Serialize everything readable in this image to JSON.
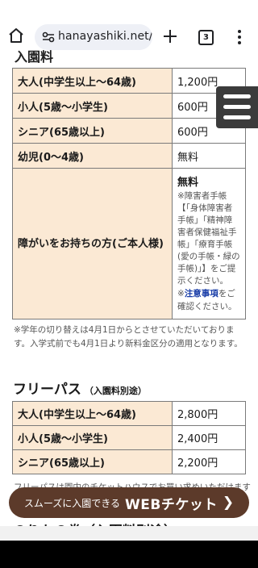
{
  "browser": {
    "url": "hanayashiki.net/f",
    "tab_count": "3"
  },
  "page": {
    "partial_heading": "入園料",
    "admission_rows": [
      {
        "label": "大人(中学生以上～64歳)",
        "value": "1,200円"
      },
      {
        "label": "小人(5歳～小学生)",
        "value": "600円"
      },
      {
        "label": "シニア(65歳以上)",
        "value": "600円"
      },
      {
        "label": "幼児(0～4歳)",
        "value": "無料"
      }
    ],
    "disability": {
      "label": "障がいをお持ちの方(ご本人様)",
      "value": "無料",
      "note": "※障害者手帳【「身体障害者手帳」「精神障害者保健福祉手帳」「療育手帳(愛の手帳・緑の手帳)」】をご提示ください。",
      "link_prefix": "※",
      "link_text": "注意事項",
      "link_suffix": "をご確認ください。"
    },
    "notice": "※学年の切り替えは4月1日からとさせていただいております。入学式前でも4月1日より新料金区分の適用となります。",
    "freepass": {
      "title": "フリーパス",
      "subtitle": "（入園料別途）",
      "rows": [
        {
          "label": "大人(中学生以上～64歳)",
          "value": "2,800円"
        },
        {
          "label": "小人(5歳～小学生)",
          "value": "2,400円"
        },
        {
          "label": "シニア(65歳以上)",
          "value": "2,200円"
        }
      ],
      "note": "フリーパスは園内のチケットハウスでお買い求めいただけます"
    },
    "cta": {
      "small": "スムーズに入園できる",
      "big": "WEBチケット",
      "arrow": "❯"
    },
    "next_heading": "のりもの券（入園料別途）"
  }
}
